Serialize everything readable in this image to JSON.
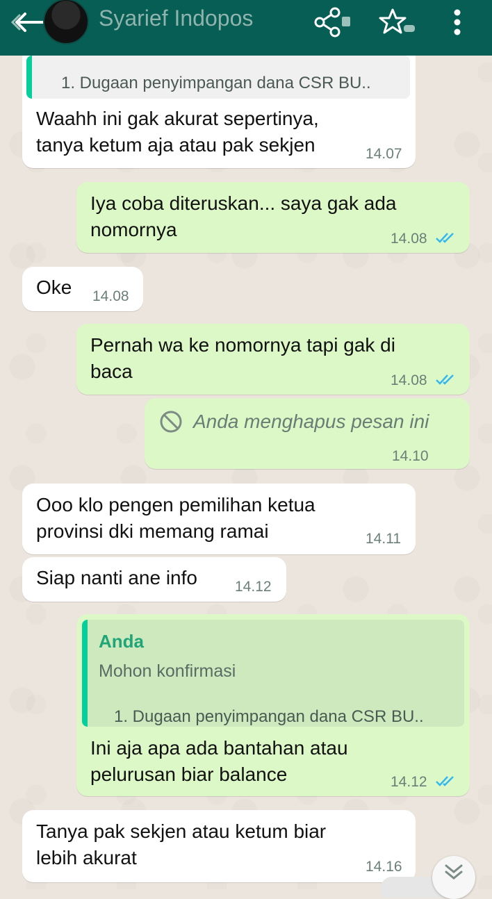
{
  "header": {
    "contact_name": "Syarief Indopos"
  },
  "icons": {
    "back": "back-arrow-icon",
    "share": "share-icon",
    "star": "star-icon",
    "menu": "more-vertical-icon",
    "deleted": "blocked-icon",
    "scroll_down": "double-chevron-down-icon",
    "read_receipt": "double-check-icon"
  },
  "colors": {
    "header": "#075e54",
    "incoming_bubble": "#ffffff",
    "outgoing_bubble": "#dcf8c6",
    "quote_bar": "#06cf9c",
    "read_ticks": "#34b7f1"
  },
  "messages": [
    {
      "direction": "in",
      "quote": {
        "snippet": "1. Dugaan penyimpangan dana CSR BU.."
      },
      "text": "Waahh ini gak akurat sepertinya,\ntanya ketum aja atau pak sekjen",
      "time": "14.07"
    },
    {
      "direction": "out",
      "text": "Iya coba diteruskan... saya gak ada\nnomornya",
      "time": "14.08"
    },
    {
      "direction": "in",
      "text": "Oke",
      "time": "14.08"
    },
    {
      "direction": "out",
      "text": "Pernah wa ke nomornya tapi gak di\nbaca",
      "time": "14.08"
    },
    {
      "direction": "out",
      "deleted": true,
      "text": "Anda menghapus pesan ini",
      "time": "14.10"
    },
    {
      "direction": "in",
      "text": "Ooo klo pengen pemilihan ketua\nprovinsi dki memang ramai",
      "time": "14.11"
    },
    {
      "direction": "in",
      "text": "Siap nanti ane info",
      "time": "14.12"
    },
    {
      "direction": "out",
      "quote": {
        "author": "Anda",
        "line1": "Mohon konfirmasi",
        "snippet": "1. Dugaan penyimpangan dana CSR BU.."
      },
      "text": "Ini aja apa ada bantahan atau\npelurusan biar balance",
      "time": "14.12"
    },
    {
      "direction": "in",
      "text": "Tanya pak sekjen atau ketum biar\nlebih akurat",
      "time": "14.16"
    }
  ]
}
